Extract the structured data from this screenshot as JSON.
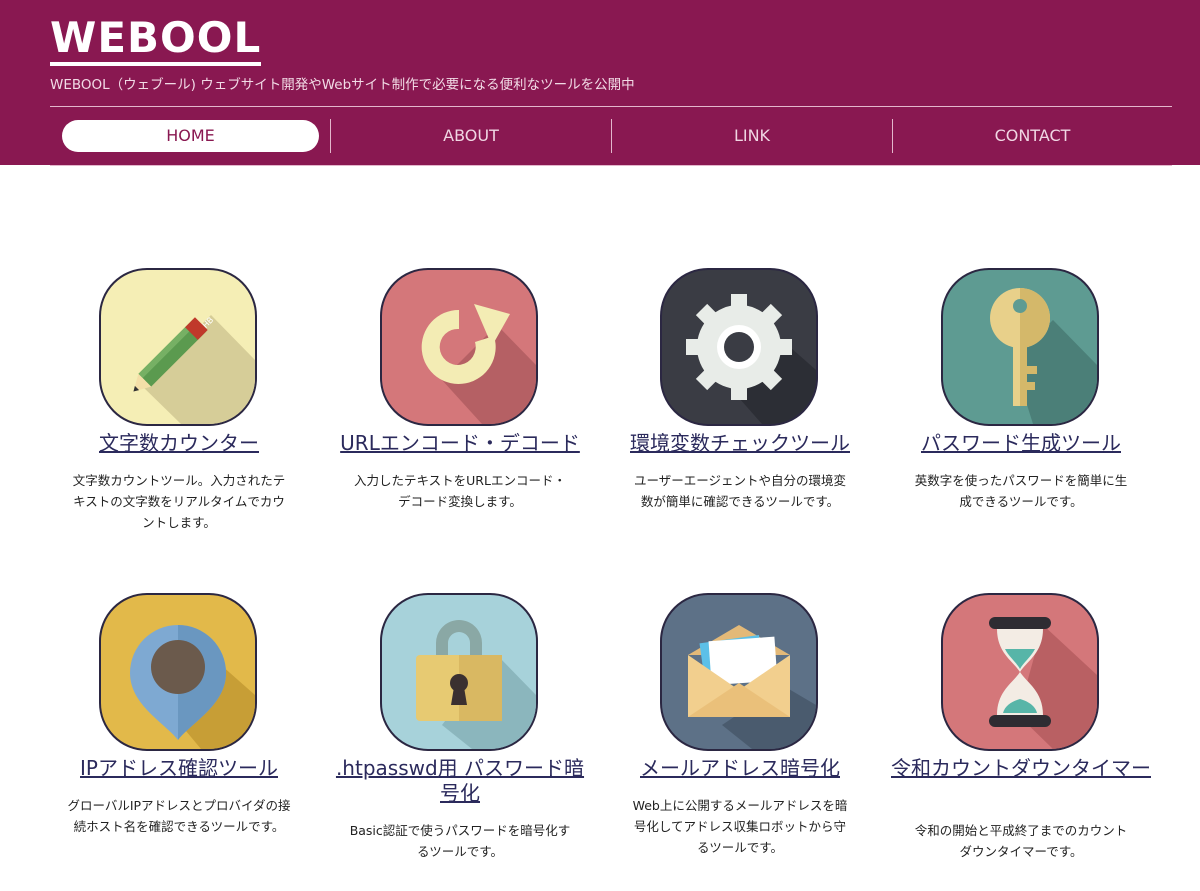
{
  "site": {
    "logo": "WEBOOL",
    "tagline": "WEBOOL（ウェブール) ウェブサイト開発やWebサイト制作で必要になる便利なツールを公開中"
  },
  "nav": {
    "items": [
      {
        "label": "HOME",
        "active": true
      },
      {
        "label": "ABOUT",
        "active": false
      },
      {
        "label": "LINK",
        "active": false
      },
      {
        "label": "CONTACT",
        "active": false
      }
    ]
  },
  "tools": [
    {
      "title": "文字数カウンター",
      "desc": "文字数カウントツール。入力されたテキストの文字数をリアルタイムでカウントします。",
      "icon": "pencil-icon",
      "bg": "#f5eeb5"
    },
    {
      "title": "URLエンコード・デコード",
      "desc": "入力したテキストをURLエンコード・デコード変換します。",
      "icon": "refresh-icon",
      "bg": "#d4777a"
    },
    {
      "title": "環境変数チェックツール",
      "desc": "ユーザーエージェントや自分の環境変数が簡単に確認できるツールです。",
      "icon": "gear-icon",
      "bg": "#3a3c44"
    },
    {
      "title": "パスワード生成ツール",
      "desc": "英数字を使ったパスワードを簡単に生成できるツールです。",
      "icon": "key-icon",
      "bg": "#5e9b92"
    },
    {
      "title": "IPアドレス確認ツール",
      "desc": "グローバルIPアドレスとプロバイダの接続ホスト名を確認できるツールです。",
      "icon": "map-pin-icon",
      "bg": "#e2b94a"
    },
    {
      "title": ".htpasswd用 パスワード暗号化",
      "desc": "Basic認証で使うパスワードを暗号化するツールです。",
      "icon": "padlock-icon",
      "bg": "#a7d2da"
    },
    {
      "title": "メールアドレス暗号化",
      "desc": "Web上に公開するメールアドレスを暗号化してアドレス収集ロボットから守るツールです。",
      "icon": "envelope-icon",
      "bg": "#5d7187"
    },
    {
      "title": "令和カウントダウンタイマー",
      "desc": "令和の開始と平成終了までのカウントダウンタイマーです。",
      "icon": "hourglass-icon",
      "bg": "#d4777a"
    }
  ]
}
